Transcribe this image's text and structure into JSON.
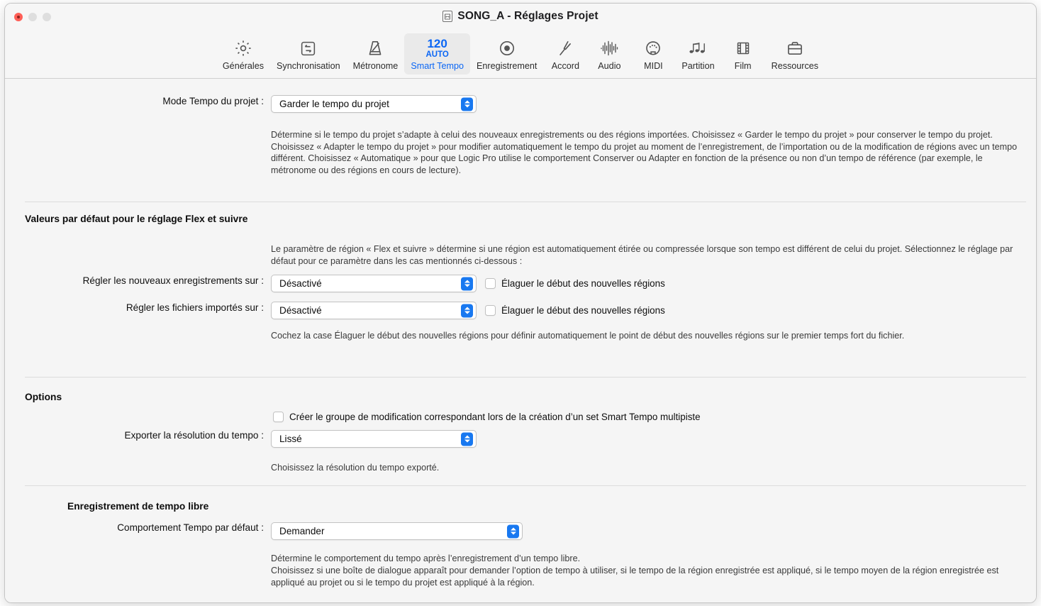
{
  "window": {
    "title": "SONG_A - Réglages Projet",
    "doc_icon": "document-icon",
    "traffic": {
      "close": "close-button",
      "minimize": "minimize-button",
      "zoom": "zoom-button"
    }
  },
  "toolbar": {
    "items": [
      {
        "label": "Générales",
        "icon": "gear-icon",
        "selected": false
      },
      {
        "label": "Synchronisation",
        "icon": "sync-arrows-icon",
        "selected": false
      },
      {
        "label": "Métronome",
        "icon": "metronome-icon",
        "selected": false
      },
      {
        "label": "Smart Tempo",
        "icon": "tempo-icon",
        "selected": true,
        "tempo_value": "120",
        "tempo_mode": "AUTO"
      },
      {
        "label": "Enregistrement",
        "icon": "record-icon",
        "selected": false
      },
      {
        "label": "Accord",
        "icon": "tuning-fork-icon",
        "selected": false
      },
      {
        "label": "Audio",
        "icon": "waveform-icon",
        "selected": false
      },
      {
        "label": "MIDI",
        "icon": "midi-icon",
        "selected": false
      },
      {
        "label": "Partition",
        "icon": "notes-icon",
        "selected": false
      },
      {
        "label": "Film",
        "icon": "filmstrip-icon",
        "selected": false
      },
      {
        "label": "Ressources",
        "icon": "briefcase-icon",
        "selected": false
      }
    ]
  },
  "content": {
    "project_tempo_mode": {
      "label": "Mode Tempo du projet :",
      "value": "Garder le tempo du projet",
      "description": "Détermine si le tempo du projet s’adapte à celui des nouveaux enregistrements ou des régions importées. Choisissez « Garder le tempo du projet » pour conserver le tempo du projet. Choisissez « Adapter le tempo du projet » pour modifier automatiquement le tempo du projet au moment de l’enregistrement, de l’importation ou de la modification de régions avec un tempo différent. Choisissez « Automatique » pour que Logic Pro utilise le comportement Conserver ou Adapter en fonction de la présence ou non d’un tempo de référence (par exemple, le métronome ou des régions en cours de lecture)."
    },
    "flex_section": {
      "heading": "Valeurs par défaut pour le réglage Flex et suivre",
      "description": "Le paramètre de région « Flex et suivre » détermine si une région est automatiquement étirée ou compressée lorsque son tempo est différent de celui du projet. Sélectionnez le réglage par défaut pour ce paramètre dans les cas mentionnés ci-dessous :",
      "new_recordings_label": "Régler les nouveaux enregistrements sur :",
      "new_recordings_value": "Désactivé",
      "new_recordings_checkbox": "Élaguer le début des nouvelles régions",
      "new_recordings_checked": false,
      "imported_files_label": "Régler les fichiers importés sur :",
      "imported_files_value": "Désactivé",
      "imported_files_checkbox": "Élaguer le début des nouvelles régions",
      "imported_files_checked": false,
      "footnote": "Cochez la case Élaguer le début des nouvelles régions pour définir automatiquement le point de début des nouvelles régions sur le premier temps fort du fichier."
    },
    "options_section": {
      "heading": "Options",
      "edit_group_checkbox": "Créer le groupe de modification correspondant lors de la création d’un set Smart Tempo multipiste",
      "edit_group_checked": false,
      "export_resolution_label": "Exporter la résolution du tempo :",
      "export_resolution_value": "Lissé",
      "export_resolution_hint": "Choisissez la résolution du tempo exporté."
    },
    "free_tempo_section": {
      "heading": "Enregistrement de tempo libre",
      "default_behavior_label": "Comportement Tempo par défaut :",
      "default_behavior_value": "Demander",
      "description_line1": "Détermine le comportement du tempo après l’enregistrement d’un tempo libre.",
      "description_line2": "Choisissez si une boîte de dialogue apparaît pour demander l’option de tempo à utiliser, si le tempo de la région enregistrée est appliqué, si le tempo moyen de la région enregistrée est appliqué au projet ou si le tempo du projet est appliqué à la région."
    }
  },
  "colors": {
    "accent_blue": "#0a66f5",
    "popup_chevron_blue": "#1878f0",
    "window_background": "#f5f5f5",
    "close_red": "#ff5f57"
  }
}
